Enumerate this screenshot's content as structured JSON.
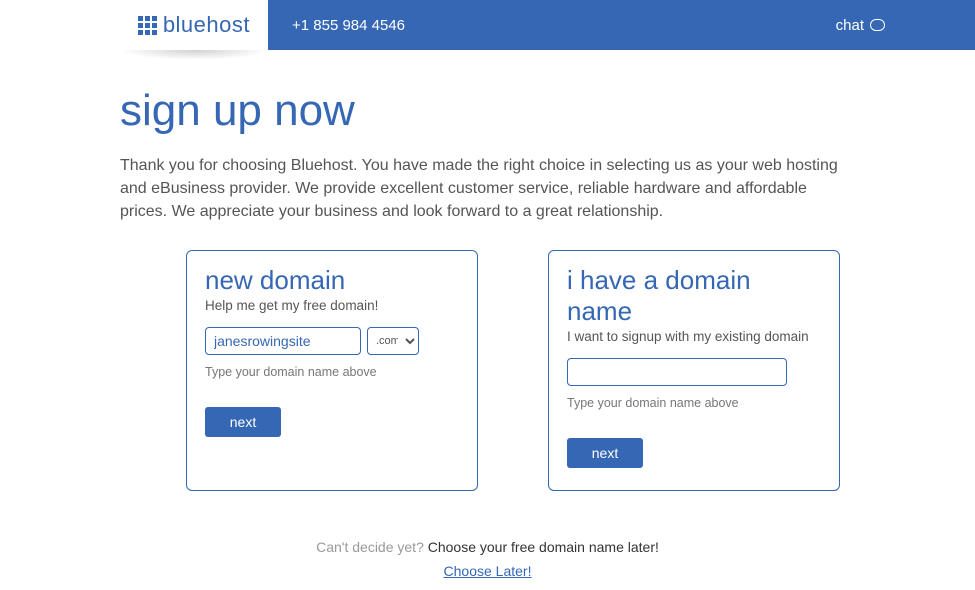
{
  "header": {
    "brand": "bluehost",
    "phone": "+1 855 984 4546",
    "chat_label": "chat"
  },
  "page": {
    "title": "sign up now",
    "intro": "Thank you for choosing Bluehost. You have made the right choice in selecting us as your web hosting and eBusiness provider. We provide excellent customer service, reliable hardware and affordable prices. We appreciate your business and look forward to a great relationship."
  },
  "new_domain": {
    "heading": "new domain",
    "sub": "Help me get my free domain!",
    "value": "janesrowingsite",
    "tld": ".com",
    "helper": "Type your domain name above",
    "button": "next"
  },
  "existing_domain": {
    "heading": "i have a domain name",
    "sub": "I want to signup with my existing domain",
    "value": "",
    "helper": "Type your domain name above",
    "button": "next"
  },
  "footer": {
    "lead": "Can't decide yet? ",
    "emph": "Choose your free domain name later!",
    "link": "Choose Later!"
  }
}
